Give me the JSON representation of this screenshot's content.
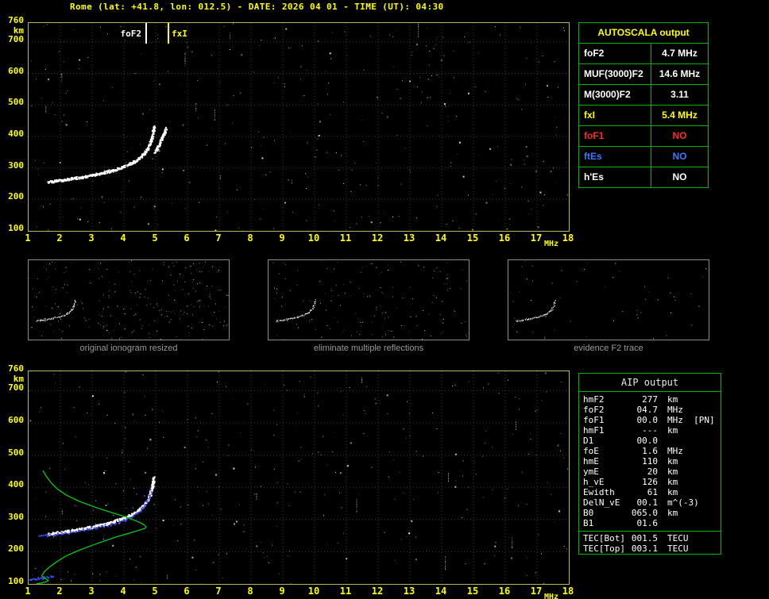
{
  "title": "Rome (lat: +41.8, lon: 012.5) - DATE: 2026 04 01 - TIME (UT): 04:30",
  "y_axis_unit": "km",
  "x_axis_unit": "MHz",
  "colors": {
    "background": "#000000",
    "title_text": "#ffff00",
    "plot_border": "#b8b85a",
    "axis_text": "#ffff00",
    "grid": "#3c3c2e",
    "table_border": "#00b400",
    "white": "#ffffff",
    "yellow": "#ffff00",
    "red": "#ff2a2a",
    "blue": "#3c78ff",
    "profile_green": "#00cc14",
    "restored_blue": "#3c50ff",
    "caption_gray": "#9a9a9a",
    "thumb_border": "#8c8c8c"
  },
  "chart_data": [
    {
      "type": "scatter",
      "title": "recorded ionogram with autoscaled characteristics",
      "xlabel": "MHz",
      "ylabel": "km",
      "xlim": [
        1,
        18
      ],
      "ylim": [
        100,
        760
      ],
      "x_ticks": [
        1,
        2,
        3,
        4,
        5,
        6,
        7,
        8,
        9,
        10,
        11,
        12,
        13,
        14,
        15,
        16,
        17,
        18
      ],
      "y_ticks": [
        760,
        700,
        600,
        500,
        400,
        300,
        200,
        100
      ],
      "grid": true,
      "noise": 340,
      "markers": [
        {
          "label": "foF2",
          "x": 4.7,
          "color": "#ffffff",
          "label_side": "left"
        },
        {
          "label": "fxI",
          "x": 5.4,
          "color": "#ffff00",
          "label_side": "right"
        }
      ],
      "series": [
        {
          "name": "F2-trace-ordinary",
          "color": "#ffffff",
          "render": "thick",
          "points": [
            [
              1.6,
              256
            ],
            [
              1.75,
              259
            ],
            [
              1.9,
              261
            ],
            [
              2.05,
              263
            ],
            [
              2.2,
              265
            ],
            [
              2.35,
              268
            ],
            [
              2.5,
              270
            ],
            [
              2.65,
              272
            ],
            [
              2.8,
              275
            ],
            [
              2.95,
              278
            ],
            [
              3.1,
              281
            ],
            [
              3.25,
              284
            ],
            [
              3.4,
              288
            ],
            [
              3.55,
              292
            ],
            [
              3.7,
              296
            ],
            [
              3.85,
              301
            ],
            [
              4.0,
              307
            ],
            [
              4.15,
              313
            ],
            [
              4.3,
              321
            ],
            [
              4.45,
              331
            ],
            [
              4.55,
              340
            ],
            [
              4.65,
              350
            ],
            [
              4.72,
              361
            ],
            [
              4.79,
              374
            ],
            [
              4.84,
              388
            ],
            [
              4.88,
              404
            ],
            [
              4.91,
              420
            ],
            [
              4.93,
              434
            ]
          ]
        },
        {
          "name": "F2-trace-extraordinary",
          "color": "#ffffff",
          "render": "thick",
          "points": [
            [
              4.97,
              352
            ],
            [
              5.06,
              368
            ],
            [
              5.15,
              387
            ],
            [
              5.24,
              408
            ],
            [
              5.31,
              428
            ]
          ]
        }
      ]
    },
    {
      "type": "scatter",
      "title": "restored ionogram with electron density profile",
      "xlabel": "MHz",
      "ylabel": "km",
      "xlim": [
        1,
        18
      ],
      "ylim": [
        100,
        760
      ],
      "x_ticks": [
        1,
        2,
        3,
        4,
        5,
        6,
        7,
        8,
        9,
        10,
        11,
        12,
        13,
        14,
        15,
        16,
        17,
        18
      ],
      "y_ticks": [
        760,
        700,
        600,
        500,
        400,
        300,
        200,
        100
      ],
      "grid": true,
      "noise": 320,
      "series": [
        {
          "name": "F2-trace",
          "color": "#ffffff",
          "render": "thick",
          "points": [
            [
              1.6,
              256
            ],
            [
              1.75,
              259
            ],
            [
              1.9,
              261
            ],
            [
              2.05,
              263
            ],
            [
              2.2,
              265
            ],
            [
              2.35,
              268
            ],
            [
              2.5,
              270
            ],
            [
              2.65,
              272
            ],
            [
              2.8,
              275
            ],
            [
              2.95,
              278
            ],
            [
              3.1,
              281
            ],
            [
              3.25,
              284
            ],
            [
              3.4,
              288
            ],
            [
              3.55,
              292
            ],
            [
              3.7,
              296
            ],
            [
              3.85,
              301
            ],
            [
              4.0,
              307
            ],
            [
              4.15,
              313
            ],
            [
              4.3,
              321
            ],
            [
              4.45,
              331
            ],
            [
              4.55,
              340
            ],
            [
              4.65,
              350
            ],
            [
              4.72,
              361
            ],
            [
              4.79,
              374
            ],
            [
              4.84,
              388
            ],
            [
              4.88,
              404
            ],
            [
              4.91,
              420
            ],
            [
              4.93,
              434
            ]
          ]
        },
        {
          "name": "restored-trace",
          "color": "#3c50ff",
          "render": "dots",
          "points": [
            [
              1.3,
              249
            ],
            [
              1.55,
              252
            ],
            [
              1.8,
              255
            ],
            [
              2.05,
              258
            ],
            [
              2.3,
              262
            ],
            [
              2.55,
              266
            ],
            [
              2.8,
              270
            ],
            [
              3.05,
              275
            ],
            [
              3.3,
              280
            ],
            [
              3.55,
              286
            ],
            [
              3.8,
              293
            ],
            [
              4.0,
              300
            ],
            [
              4.2,
              309
            ],
            [
              4.35,
              318
            ],
            [
              4.5,
              330
            ],
            [
              4.6,
              342
            ],
            [
              4.7,
              357
            ],
            [
              4.78,
              374
            ],
            [
              4.84,
              392
            ]
          ]
        },
        {
          "name": "E-region-trace",
          "color": "#3c50ff",
          "render": "dots",
          "points": [
            [
              1.0,
              113
            ],
            [
              1.15,
              116
            ],
            [
              1.3,
              118
            ],
            [
              1.45,
              121
            ],
            [
              1.6,
              124
            ],
            [
              1.75,
              127
            ]
          ]
        },
        {
          "name": "electron-density-profile",
          "color": "#00cc14",
          "line": true,
          "points": [
            [
              1.25,
              100
            ],
            [
              1.45,
              104
            ],
            [
              1.58,
              108
            ],
            [
              1.62,
              111
            ],
            [
              1.52,
              117
            ],
            [
              1.44,
              122
            ],
            [
              1.42,
              126
            ],
            [
              1.5,
              138
            ],
            [
              1.65,
              152
            ],
            [
              1.9,
              170
            ],
            [
              2.2,
              188
            ],
            [
              2.6,
              205
            ],
            [
              3.0,
              220
            ],
            [
              3.4,
              234
            ],
            [
              3.8,
              247
            ],
            [
              4.15,
              257
            ],
            [
              4.45,
              266
            ],
            [
              4.65,
              272
            ],
            [
              4.7,
              277
            ],
            [
              4.62,
              285
            ],
            [
              4.4,
              295
            ],
            [
              4.05,
              308
            ],
            [
              3.6,
              322
            ],
            [
              3.1,
              338
            ],
            [
              2.6,
              356
            ],
            [
              2.2,
              375
            ],
            [
              1.9,
              395
            ],
            [
              1.7,
              415
            ],
            [
              1.55,
              435
            ],
            [
              1.45,
              452
            ]
          ]
        }
      ]
    }
  ],
  "autoscala_table": {
    "title": "AUTOSCALA output",
    "rows": [
      {
        "param": "foF2",
        "value": "4.7 MHz",
        "color": "#ffffff"
      },
      {
        "param": "MUF(3000)F2",
        "value": "14.6 MHz",
        "color": "#ffffff"
      },
      {
        "param": "M(3000)F2",
        "value": "3.11",
        "color": "#ffffff"
      },
      {
        "param": "fxI",
        "value": "5.4 MHz",
        "color": "#ffff00"
      },
      {
        "param": "foF1",
        "value": "NO",
        "color": "#ff2a2a"
      },
      {
        "param": "ftEs",
        "value": "NO",
        "color": "#3c78ff"
      },
      {
        "param": "h'Es",
        "value": "NO",
        "color": "#ffffff"
      }
    ]
  },
  "thumbnails": [
    {
      "caption": "original ionogram resized",
      "noise": 240
    },
    {
      "caption": "eliminate multiple reflections",
      "noise": 150
    },
    {
      "caption": "evidence F2 trace",
      "noise": 55
    }
  ],
  "aip_table": {
    "title": "AIP output",
    "rows": [
      {
        "param": "hmF2",
        "value": "277",
        "unit": "km"
      },
      {
        "param": "foF2",
        "value": "04.7",
        "unit": "MHz"
      },
      {
        "param": "foF1",
        "value": "00.0",
        "unit": "MHz  [PN]"
      },
      {
        "param": "hmF1",
        "value": "---",
        "unit": "km"
      },
      {
        "param": "D1",
        "value": "00.0",
        "unit": ""
      },
      {
        "param": "foE",
        "value": "1.6",
        "unit": "MHz"
      },
      {
        "param": "hmE",
        "value": "110",
        "unit": "km"
      },
      {
        "param": "ymE",
        "value": "20",
        "unit": "km"
      },
      {
        "param": "h_vE",
        "value": "126",
        "unit": "km"
      },
      {
        "param": "Ewidth",
        "value": "61",
        "unit": "km"
      },
      {
        "param": "DelN_vE",
        "value": "00.1",
        "unit": "m^(-3)"
      },
      {
        "param": "B0",
        "value": "065.0",
        "unit": "km"
      },
      {
        "param": "B1",
        "value": "01.6",
        "unit": ""
      }
    ],
    "tec_rows": [
      {
        "param": "TEC[Bot]",
        "value": "001.5",
        "unit": "TECU"
      },
      {
        "param": "TEC[Top]",
        "value": "003.1",
        "unit": "TECU"
      }
    ]
  }
}
